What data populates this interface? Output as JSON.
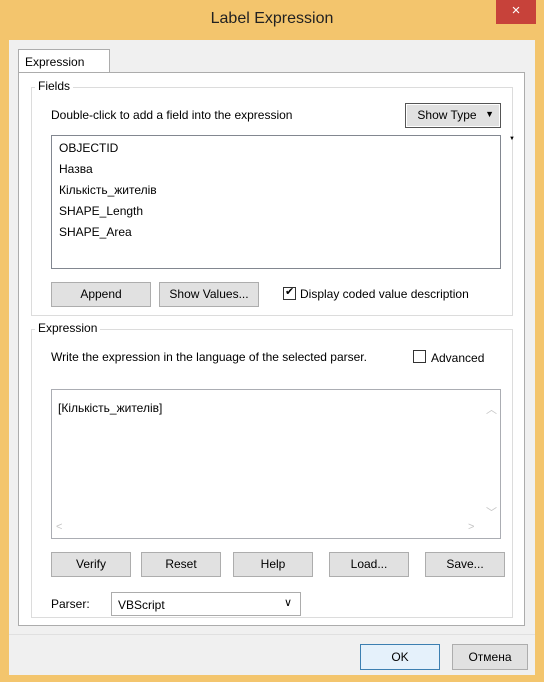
{
  "window": {
    "title": "Label Expression",
    "close_glyph": "×"
  },
  "tab": {
    "label": "Expression"
  },
  "fields": {
    "group_title": "Fields",
    "instruction": "Double-click to add a field into the expression",
    "show_type_label": "Show Type",
    "items": [
      "OBJECTID",
      "Назва",
      "Кількість_жителів",
      "SHAPE_Length",
      "SHAPE_Area"
    ],
    "append_label": "Append",
    "show_values_label": "Show Values...",
    "display_coded_label": "Display coded value description",
    "display_coded_checked": true
  },
  "expression": {
    "group_title": "Expression",
    "instruction": "Write the expression in the language of the selected parser.",
    "advanced_label": "Advanced",
    "advanced_checked": false,
    "text": "[Кількість_жителів]",
    "buttons": {
      "verify": "Verify",
      "reset": "Reset",
      "help": "Help",
      "load": "Load...",
      "save": "Save..."
    },
    "parser_label": "Parser:",
    "parser_value": "VBScript"
  },
  "footer": {
    "ok_label": "OK",
    "cancel_label": "Отмена"
  },
  "colors": {
    "frame": "#f3c56d",
    "close": "#c7423a"
  }
}
